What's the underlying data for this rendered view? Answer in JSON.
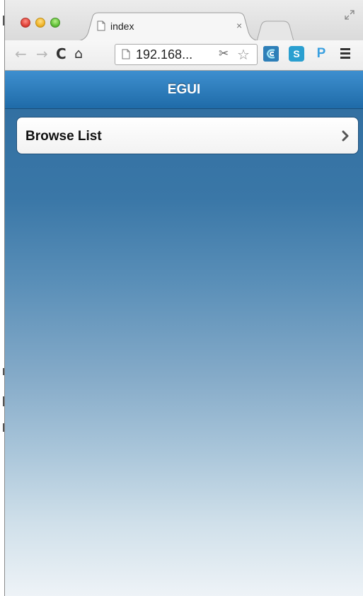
{
  "browser": {
    "tab": {
      "title": "index",
      "close_glyph": "×",
      "icon": "page-icon"
    },
    "toolbar": {
      "back_glyph": "←",
      "forward_glyph": "→",
      "reload_glyph": "C",
      "home_glyph": "⌂",
      "url": "192.168...",
      "scissors_glyph": "✂",
      "star_glyph": "☆",
      "extensions": [
        {
          "icon": "ext-wave-icon",
          "label": ""
        },
        {
          "icon": "ext-s-icon",
          "label": "S"
        },
        {
          "icon": "ext-p-icon",
          "label": "P"
        }
      ],
      "menu_icon": "hamburger-menu-icon"
    }
  },
  "app": {
    "header": {
      "title": "EGUI"
    },
    "list": [
      {
        "label": "Browse List",
        "icon": "chevron-right-icon"
      }
    ],
    "colors": {
      "header_top": "#3e8fcf",
      "header_bottom": "#1f6ba8",
      "background_top": "#2f6da0",
      "background_bottom": "#eef3f7"
    }
  }
}
